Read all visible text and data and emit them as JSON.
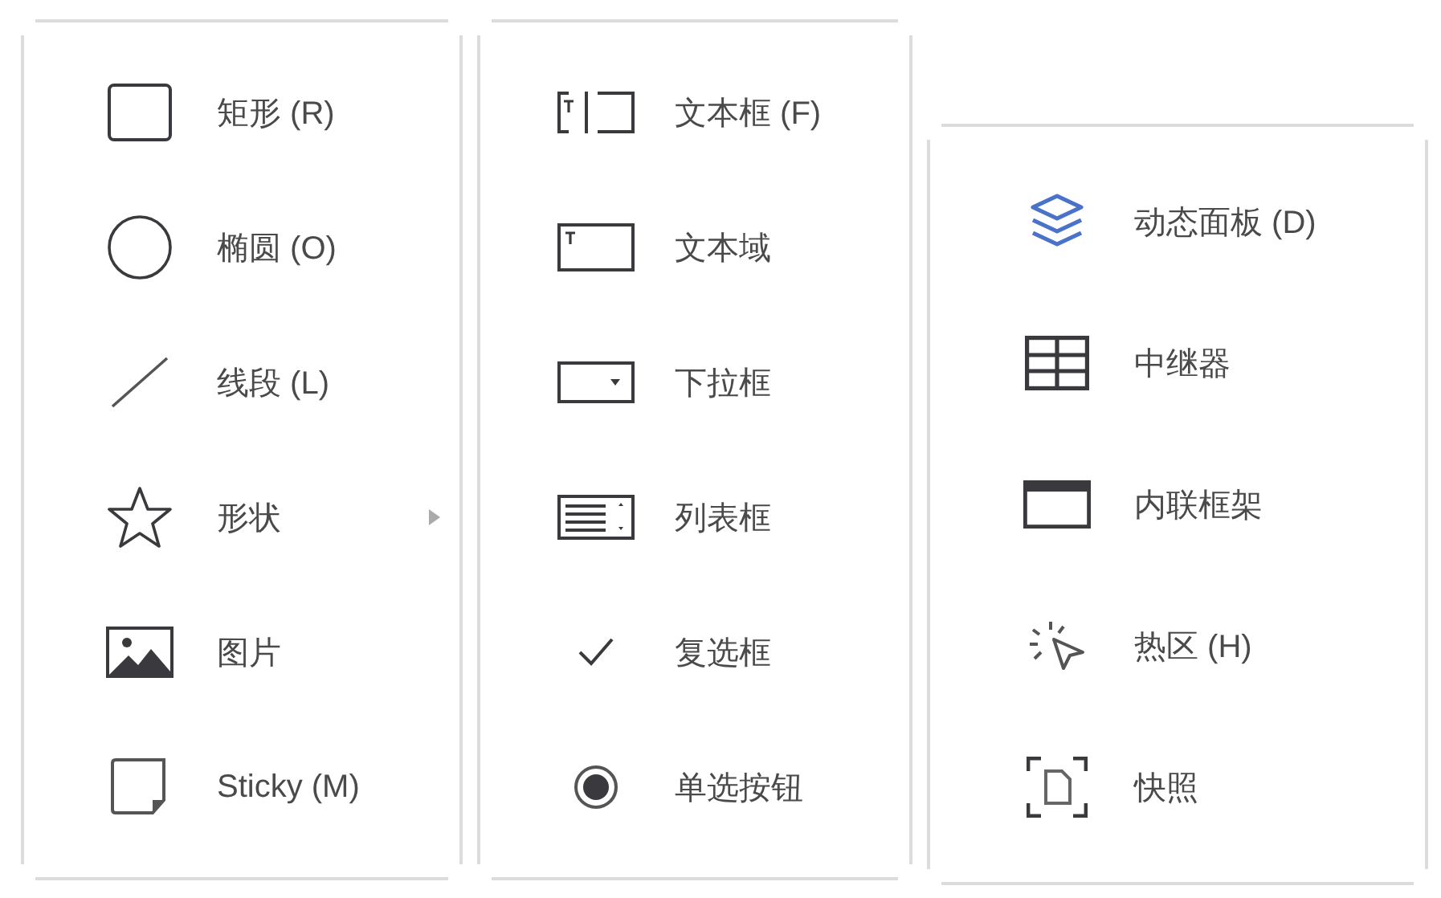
{
  "panels": [
    {
      "items": [
        {
          "label": "矩形 (R)",
          "has_submenu": false
        },
        {
          "label": "椭圆 (O)",
          "has_submenu": false
        },
        {
          "label": "线段 (L)",
          "has_submenu": false
        },
        {
          "label": "形状",
          "has_submenu": true
        },
        {
          "label": "图片",
          "has_submenu": false
        },
        {
          "label": "Sticky (M)",
          "has_submenu": false
        }
      ]
    },
    {
      "items": [
        {
          "label": "文本框 (F)",
          "has_submenu": false
        },
        {
          "label": "文本域",
          "has_submenu": false
        },
        {
          "label": "下拉框",
          "has_submenu": false
        },
        {
          "label": "列表框",
          "has_submenu": false
        },
        {
          "label": "复选框",
          "has_submenu": false
        },
        {
          "label": "单选按钮",
          "has_submenu": false
        }
      ]
    },
    {
      "items": [
        {
          "label": "动态面板 (D)",
          "has_submenu": false
        },
        {
          "label": "中继器",
          "has_submenu": false
        },
        {
          "label": "内联框架",
          "has_submenu": false
        },
        {
          "label": "热区 (H)",
          "has_submenu": false
        },
        {
          "label": "快照",
          "has_submenu": false
        }
      ]
    }
  ]
}
